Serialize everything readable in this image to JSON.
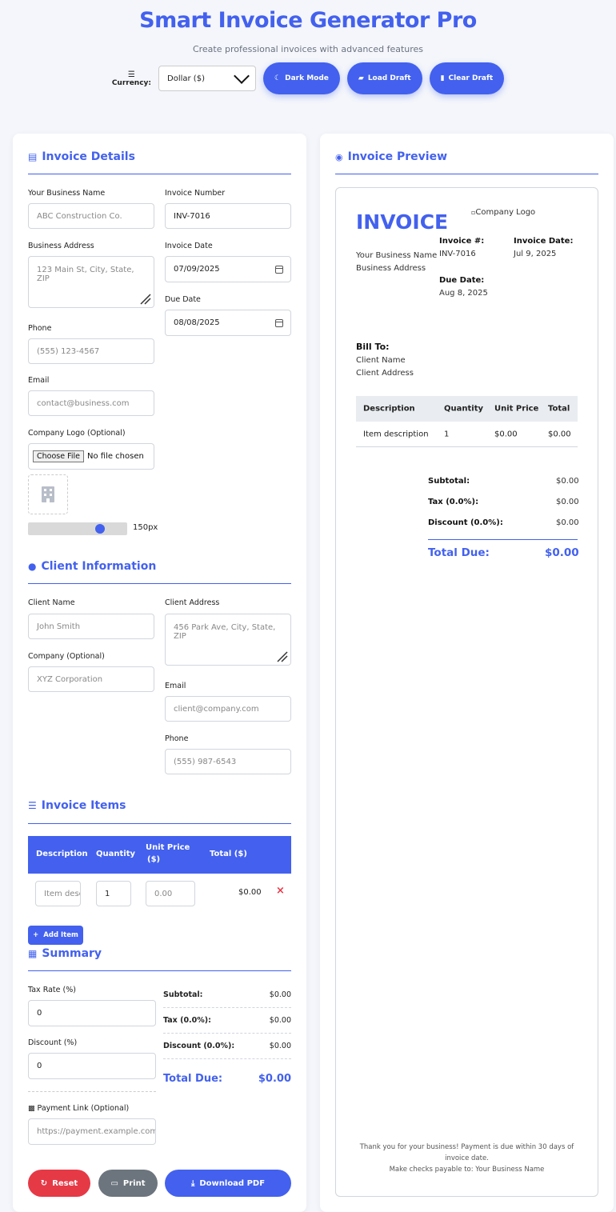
{
  "header": {
    "title": "Smart Invoice Generator Pro",
    "subtitle": "Create professional invoices with advanced features"
  },
  "toolbar": {
    "currency_label": "Currency:",
    "currency_value": "Dollar ($)",
    "dark_mode": "Dark Mode",
    "load_draft": "Load Draft",
    "clear_draft": "Clear Draft"
  },
  "invoice_details": {
    "title": "Invoice Details",
    "business_name_label": "Your Business Name",
    "business_name_placeholder": "ABC Construction Co.",
    "invoice_number_label": "Invoice Number",
    "invoice_number_value": "INV-7016",
    "business_address_label": "Business Address",
    "business_address_placeholder": "123 Main St, City, State, ZIP",
    "invoice_date_label": "Invoice Date",
    "invoice_date_value": "07/09/2025",
    "due_date_label": "Due Date",
    "due_date_value": "08/08/2025",
    "phone_label": "Phone",
    "phone_placeholder": "(555) 123-4567",
    "email_label": "Email",
    "email_placeholder": "contact@business.com",
    "logo_label": "Company Logo (Optional)",
    "choose_file": "Choose File",
    "no_file": "No file chosen",
    "logo_size": "150px"
  },
  "client": {
    "title": "Client Information",
    "name_label": "Client Name",
    "name_placeholder": "John Smith",
    "address_label": "Client Address",
    "address_placeholder": "456 Park Ave, City, State, ZIP",
    "company_label": "Company (Optional)",
    "company_placeholder": "XYZ Corporation",
    "email_label": "Email",
    "email_placeholder": "client@company.com",
    "phone_label": "Phone",
    "phone_placeholder": "(555) 987-6543"
  },
  "items": {
    "title": "Invoice Items",
    "headers": [
      "Description",
      "Quantity",
      "Unit Price ($)",
      "Total ($)"
    ],
    "unit_price_line1": "Unit Price",
    "unit_price_line2": "($)",
    "row": {
      "description_placeholder": "Item description",
      "quantity": "1",
      "unit_price_placeholder": "0.00",
      "total": "$0.00"
    },
    "add_item": "Add Item"
  },
  "summary": {
    "title": "Summary",
    "tax_label": "Tax Rate (%)",
    "tax_value": "0",
    "discount_label": "Discount (%)",
    "discount_value": "0",
    "payment_label": "Payment Link (Optional)",
    "payment_placeholder": "https://payment.example.com",
    "subtotal_label": "Subtotal:",
    "subtotal_value": "$0.00",
    "tax_row_label": "Tax (0.0%):",
    "tax_row_value": "$0.00",
    "discount_row_label": "Discount (0.0%):",
    "discount_row_value": "$0.00",
    "total_label": "Total Due:",
    "total_value": "$0.00"
  },
  "actions": {
    "reset": "Reset",
    "print": "Print",
    "download": "Download PDF"
  },
  "preview": {
    "title": "Invoice Preview",
    "invoice_heading": "INVOICE",
    "logo_alt": "Company Logo",
    "business_name": "Your Business Name",
    "business_address": "Business Address",
    "invoice_no_label": "Invoice #:",
    "invoice_no_value": "INV-7016",
    "invoice_date_label": "Invoice Date:",
    "invoice_date_value": "Jul 9, 2025",
    "due_date_label": "Due Date:",
    "due_date_value": "Aug 8, 2025",
    "bill_to_label": "Bill To:",
    "client_name": "Client Name",
    "client_address": "Client Address",
    "table_headers": [
      "Description",
      "Quantity",
      "Unit Price",
      "Total"
    ],
    "table_row": [
      "Item description",
      "1",
      "$0.00",
      "$0.00"
    ],
    "subtotal_label": "Subtotal:",
    "subtotal_value": "$0.00",
    "tax_label": "Tax (0.0%):",
    "tax_value": "$0.00",
    "discount_label": "Discount (0.0%):",
    "discount_value": "$0.00",
    "total_label": "Total Due:",
    "total_value": "$0.00",
    "footer_line1": "Thank you for your business! Payment is due within 30 days of",
    "footer_line2": "invoice date.",
    "footer_line3": "Make checks payable to: Your Business Name"
  },
  "colors": {
    "accent": "#4361ee",
    "danger": "#e63946",
    "secondary": "#6c757d"
  },
  "logo_size_slider": 0.75
}
